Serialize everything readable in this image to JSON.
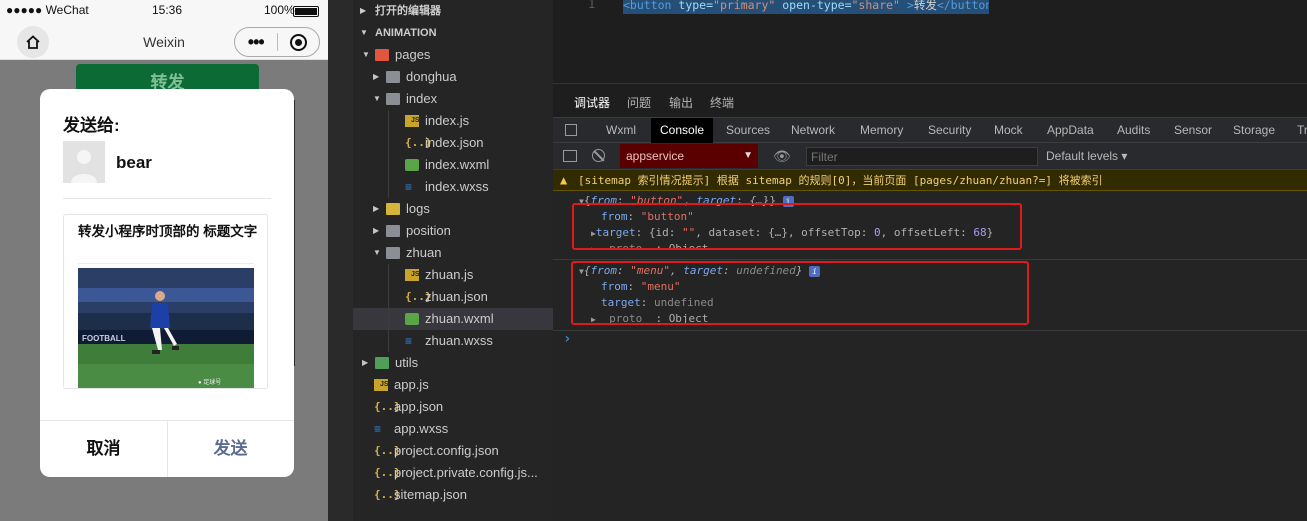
{
  "simulator": {
    "status": {
      "carrier": "●●●●● WeChat",
      "time": "15:36",
      "battery": "100%"
    },
    "nav": {
      "title": "Weixin",
      "more_glyph": "•••"
    },
    "page_button": "转发",
    "dialog": {
      "send_to": "发送给:",
      "user": "bear",
      "card_title": "转发小程序时顶部的 标题文字",
      "cancel": "取消",
      "send": "发送"
    }
  },
  "explorer": {
    "open_editors": "打开的编辑器",
    "project": "ANIMATION",
    "rows": [
      {
        "label": "pages",
        "type": "folder-red",
        "depth": 1,
        "caret": "open"
      },
      {
        "label": "donghua",
        "type": "folder",
        "depth": 2,
        "caret": "closed"
      },
      {
        "label": "index",
        "type": "folder",
        "depth": 2,
        "caret": "open"
      },
      {
        "label": "index.js",
        "type": "js",
        "depth": 3
      },
      {
        "label": "index.json",
        "type": "json",
        "depth": 3
      },
      {
        "label": "index.wxml",
        "type": "wxml",
        "depth": 3
      },
      {
        "label": "index.wxss",
        "type": "wxss",
        "depth": 3
      },
      {
        "label": "logs",
        "type": "folder-yellow",
        "depth": 2,
        "caret": "closed"
      },
      {
        "label": "position",
        "type": "folder",
        "depth": 2,
        "caret": "closed"
      },
      {
        "label": "zhuan",
        "type": "folder",
        "depth": 2,
        "caret": "open"
      },
      {
        "label": "zhuan.js",
        "type": "js",
        "depth": 3
      },
      {
        "label": "zhuan.json",
        "type": "json",
        "depth": 3
      },
      {
        "label": "zhuan.wxml",
        "type": "wxml",
        "depth": 3,
        "selected": true
      },
      {
        "label": "zhuan.wxss",
        "type": "wxss",
        "depth": 3
      },
      {
        "label": "utils",
        "type": "folder-green",
        "depth": 1,
        "caret": "closed"
      },
      {
        "label": "app.js",
        "type": "js",
        "depth": 1
      },
      {
        "label": "app.json",
        "type": "json",
        "depth": 1
      },
      {
        "label": "app.wxss",
        "type": "wxss",
        "depth": 1
      },
      {
        "label": "project.config.json",
        "type": "json",
        "depth": 1
      },
      {
        "label": "project.private.config.js...",
        "type": "json",
        "depth": 1
      },
      {
        "label": "sitemap.json",
        "type": "json",
        "depth": 1
      }
    ]
  },
  "editor": {
    "line": "1",
    "code": {
      "open_tag": "<button",
      "attr1": " type=",
      "val1": "\"primary\"",
      "attr2": " open-type=",
      "val2": "\"share\"",
      "close_bracket": " >",
      "text": "转发",
      "end_tag": "</button>"
    }
  },
  "devtools": {
    "top_tabs": [
      "调试器",
      "问题",
      "输出",
      "终端"
    ],
    "panel_tabs": [
      "Wxml",
      "Console",
      "Sources",
      "Network",
      "Memory",
      "Security",
      "Mock",
      "AppData",
      "Audits",
      "Sensor",
      "Storage",
      "Tr"
    ],
    "context": "appservice",
    "filter_placeholder": "Filter",
    "levels": "Default levels ▾",
    "console": {
      "warning": "[sitemap 索引情况提示] 根据 sitemap 的规则[0]，当前页面 [pages/zhuan/zhuan?=] 将被索引",
      "entry1": {
        "summary_from": "\"button\"",
        "summary_target": "{…}",
        "from_value": "\"button\"",
        "target_id": "\"\"",
        "target_dataset": "{…}",
        "offset_top": "0",
        "offset_left": "68",
        "proto": "Object"
      },
      "entry2": {
        "summary_from": "\"menu\"",
        "summary_target": "undefined",
        "from_value": "\"menu\"",
        "target_value": "undefined",
        "proto": "Object"
      },
      "prompt": "›"
    }
  },
  "colors": {
    "highlight_box": "#e0191b",
    "page_button": "#0c6b35",
    "send_button_text": "#5a6c8f"
  }
}
